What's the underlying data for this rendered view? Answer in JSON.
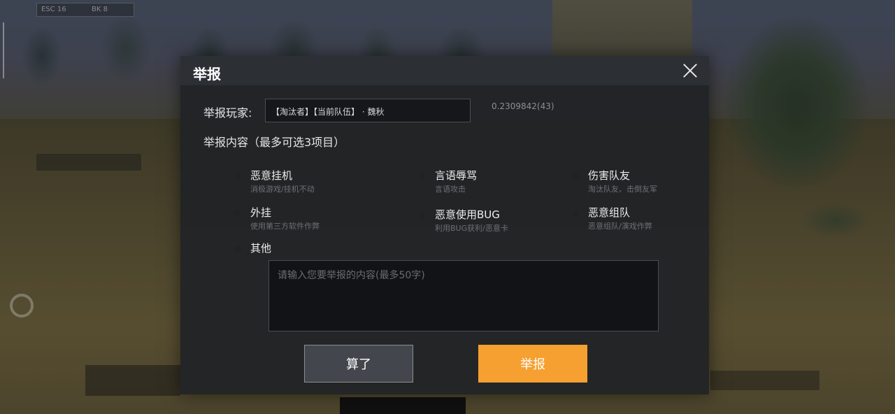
{
  "modal": {
    "title": "举报",
    "player_label": "举报玩家:",
    "player_value": "【淘汰者】【当前队伍】  · 魏秋",
    "player_id": "0.2309842(43)",
    "content_label": "举报内容（最多可选3项目）",
    "options": [
      {
        "title": "恶意挂机",
        "sub": "消极游戏/挂机不动"
      },
      {
        "title": "言语辱骂",
        "sub": "言语攻击"
      },
      {
        "title": "伤害队友",
        "sub": "淘汰队友、击倒友军"
      },
      {
        "title": "外挂",
        "sub": "使用第三方软件作弊"
      },
      {
        "title": "恶意使用BUG",
        "sub": "利用BUG获利/恶意卡"
      },
      {
        "title": "恶意组队",
        "sub": "恶意组队/演戏作弊"
      },
      {
        "title": "其他",
        "sub": ""
      }
    ],
    "textarea_placeholder": "请输入您要举报的内容(最多50字)",
    "cancel_label": "算了",
    "report_label": "举报"
  },
  "colors": {
    "accent": "#f5a030",
    "panel": "#202226",
    "header": "#2c2f34"
  },
  "hud": {
    "top_left_a": "ESC 16",
    "top_left_b": "BK 8"
  }
}
